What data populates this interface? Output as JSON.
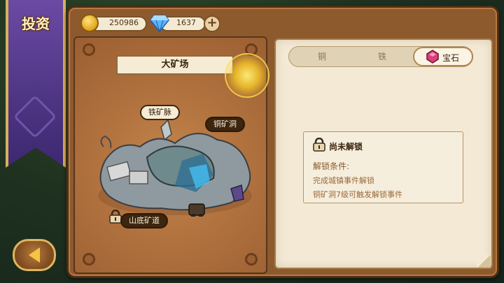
{
  "banner": {
    "title": "投资"
  },
  "currency": {
    "gold": "250986",
    "gems": "1637"
  },
  "mine": {
    "title": "大矿场",
    "labels": {
      "iron_vein": "铁矿脉",
      "copper_cave": "铜矿洞",
      "mountain_tunnel": "山底矿道"
    }
  },
  "tabs": [
    {
      "label": "铜"
    },
    {
      "label": "铁"
    },
    {
      "label": "宝石"
    }
  ],
  "active_tab": "宝石",
  "lock_card": {
    "title": "尚未解锁",
    "condition_heading": "解锁条件:",
    "conditions": [
      "完成城镇事件解锁",
      "铜矿洞7级可触发解锁事件"
    ]
  },
  "colors": {
    "banner": "#4e3583",
    "frame_wood": "#8d5a2e",
    "panel_paper": "#f3e9d5",
    "gem_accent": "#c8306a"
  }
}
